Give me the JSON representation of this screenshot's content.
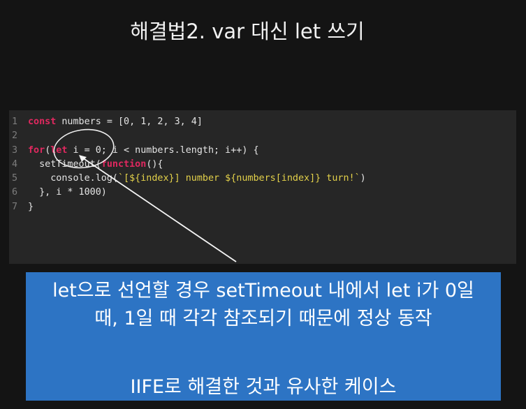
{
  "slide": {
    "title": "해결법2. var 대신 let 쓰기"
  },
  "colors": {
    "background": "#141414",
    "code_background": "#262626",
    "keyword": "#e0285f",
    "string": "#e3d14a",
    "caption_background": "#2d74c4"
  },
  "code": {
    "lines": [
      {
        "number": "1",
        "tokens": [
          {
            "t": "const",
            "c": "kw"
          },
          {
            "t": " numbers = [0, 1, 2, 3, 4]",
            "c": ""
          }
        ]
      },
      {
        "number": "2",
        "tokens": []
      },
      {
        "number": "3",
        "tokens": [
          {
            "t": "for",
            "c": "kw"
          },
          {
            "t": "(",
            "c": ""
          },
          {
            "t": "let",
            "c": "kw"
          },
          {
            "t": " i = 0; i < numbers.length; i++) {",
            "c": ""
          }
        ]
      },
      {
        "number": "4",
        "tokens": [
          {
            "t": "  setTimeout(",
            "c": ""
          },
          {
            "t": "function",
            "c": "kw"
          },
          {
            "t": "(){",
            "c": ""
          }
        ]
      },
      {
        "number": "5",
        "tokens": [
          {
            "t": "    console.log(",
            "c": ""
          },
          {
            "t": "`[${index}] number ${numbers[index]} turn!`",
            "c": "str"
          },
          {
            "t": ")",
            "c": ""
          }
        ]
      },
      {
        "number": "6",
        "tokens": [
          {
            "t": "  }, i * 1000)",
            "c": ""
          }
        ]
      },
      {
        "number": "7",
        "tokens": [
          {
            "t": "}",
            "c": ""
          }
        ]
      }
    ]
  },
  "caption": {
    "line1": "let으로 선언할 경우 setTimeout 내에서 let i가 0일",
    "line2": "때, 1일 때 각각 참조되기 때문에 정상 동작",
    "line3": "IIFE로 해결한 것과 유사한 케이스"
  }
}
